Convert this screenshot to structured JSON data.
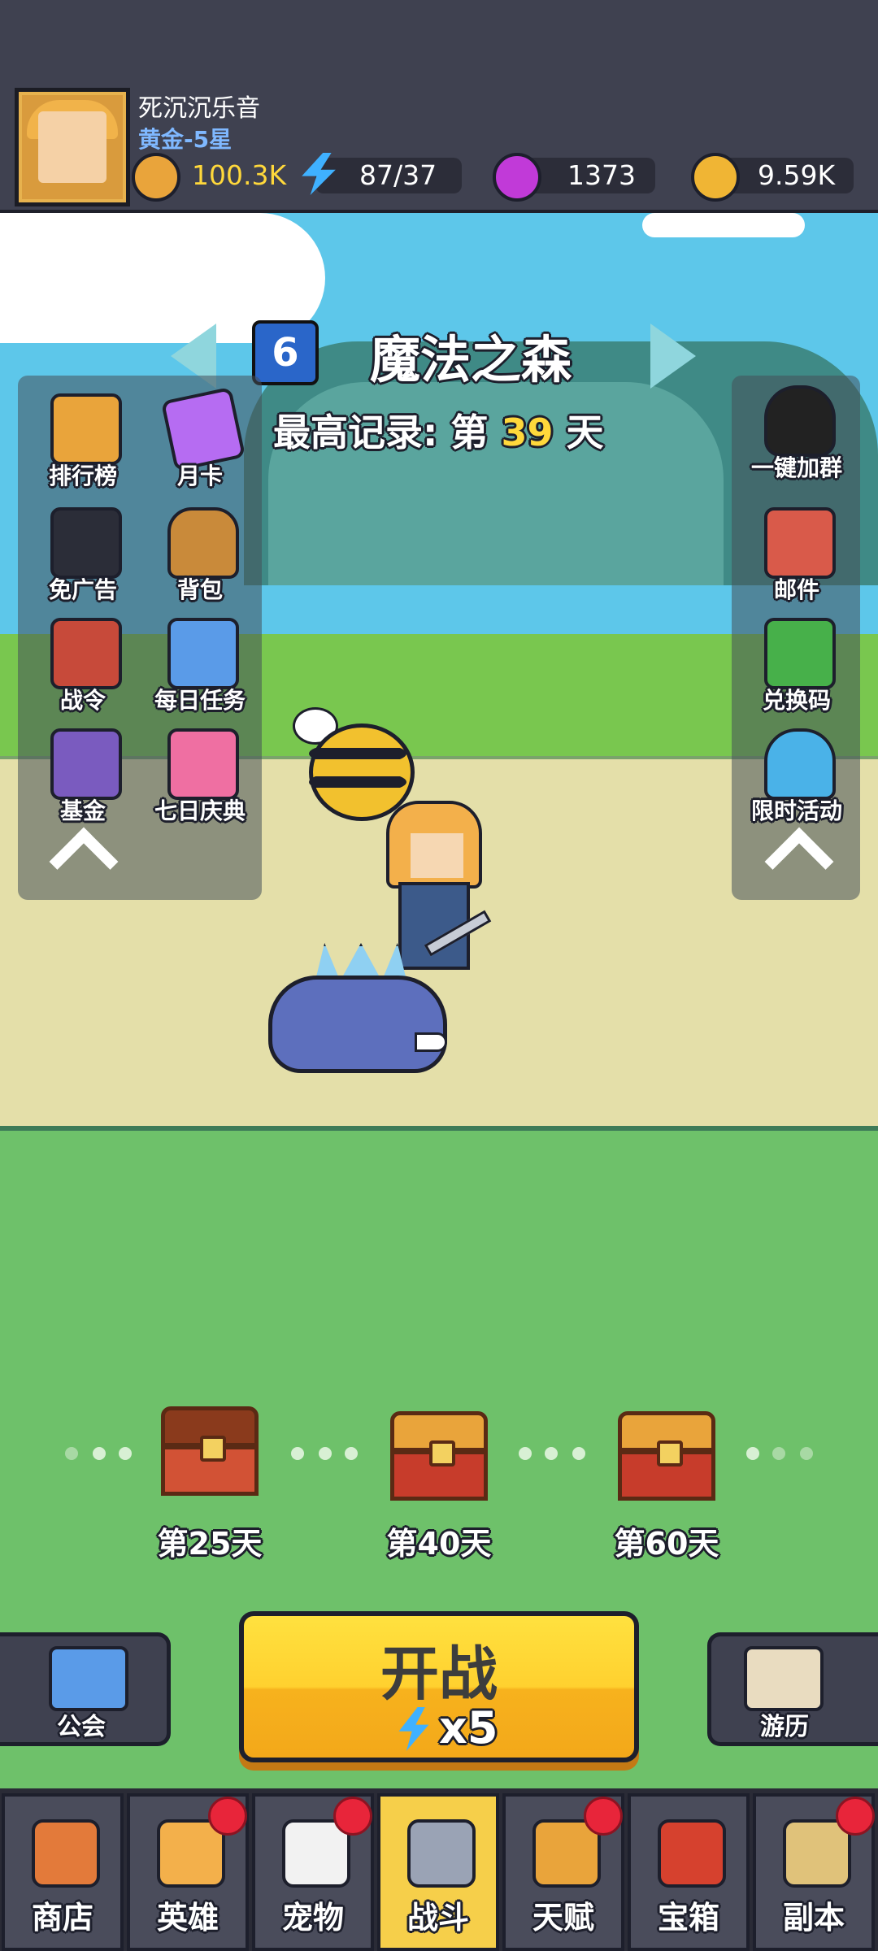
{
  "player": {
    "name": "死沉沉乐音",
    "rank": "黄金-5星",
    "power": "100.3K",
    "energy": "87/37",
    "gems": "1373",
    "gold": "9.59K"
  },
  "stage": {
    "number": "6",
    "name": "魔法之森",
    "record_prefix": "最高记录: 第",
    "record_day": "39",
    "record_suffix": "天"
  },
  "left_menu": [
    {
      "label": "排行榜",
      "icon": "trophy-banner-icon",
      "color": "#e9a43b"
    },
    {
      "label": "月卡",
      "icon": "month-card-icon",
      "color": "#b66cf2"
    },
    {
      "label": "免广告",
      "icon": "no-ads-icon",
      "color": "#2b2d38"
    },
    {
      "label": "背包",
      "icon": "backpack-icon",
      "color": "#c98a3a"
    },
    {
      "label": "战令",
      "icon": "battle-pass-icon",
      "color": "#c74a3a"
    },
    {
      "label": "每日任务",
      "icon": "daily-task-icon",
      "color": "#5a9be8"
    },
    {
      "label": "基金",
      "icon": "fund-safe-icon",
      "color": "#7a5bbf"
    },
    {
      "label": "七日庆典",
      "icon": "gift-box-icon",
      "color": "#ef6fa2"
    }
  ],
  "right_menu": [
    {
      "label": "一键加群",
      "icon": "penguin-icon",
      "color": "#222222"
    },
    {
      "label": "邮件",
      "icon": "mail-icon",
      "color": "#d95a4a"
    },
    {
      "label": "兑换码",
      "icon": "redeem-code-icon",
      "color": "#47b04a"
    },
    {
      "label": "限时活动",
      "icon": "gacha-machine-icon",
      "color": "#4ab2e8"
    }
  ],
  "chests": [
    {
      "label": "第25天",
      "state": "opened"
    },
    {
      "label": "第40天",
      "state": "closed"
    },
    {
      "label": "第60天",
      "state": "closed"
    }
  ],
  "actions": {
    "guild": "公会",
    "journey": "游历",
    "battle": "开战",
    "battle_cost": "x5"
  },
  "nav": [
    {
      "label": "商店",
      "icon": "shop-icon",
      "color": "#e37a3a",
      "badge": false,
      "active": false
    },
    {
      "label": "英雄",
      "icon": "hero-icon",
      "color": "#f3b04b",
      "badge": true,
      "active": false
    },
    {
      "label": "宠物",
      "icon": "pet-icon",
      "color": "#f2f2f2",
      "badge": true,
      "active": false
    },
    {
      "label": "战斗",
      "icon": "crossed-swords-icon",
      "color": "#9aa3b5",
      "badge": false,
      "active": true
    },
    {
      "label": "天赋",
      "icon": "talent-fist-icon",
      "color": "#e9a43b",
      "badge": true,
      "active": false
    },
    {
      "label": "宝箱",
      "icon": "chest-icon",
      "color": "#d6412e",
      "badge": false,
      "active": false
    },
    {
      "label": "副本",
      "icon": "map-scroll-icon",
      "color": "#e0c27a",
      "badge": true,
      "active": false
    }
  ],
  "colors": {
    "record_highlight": "#ffd83b",
    "rank_text": "#7fb8ff",
    "badge_red": "#e8253a",
    "battle_yellow": "#ffd12f"
  }
}
